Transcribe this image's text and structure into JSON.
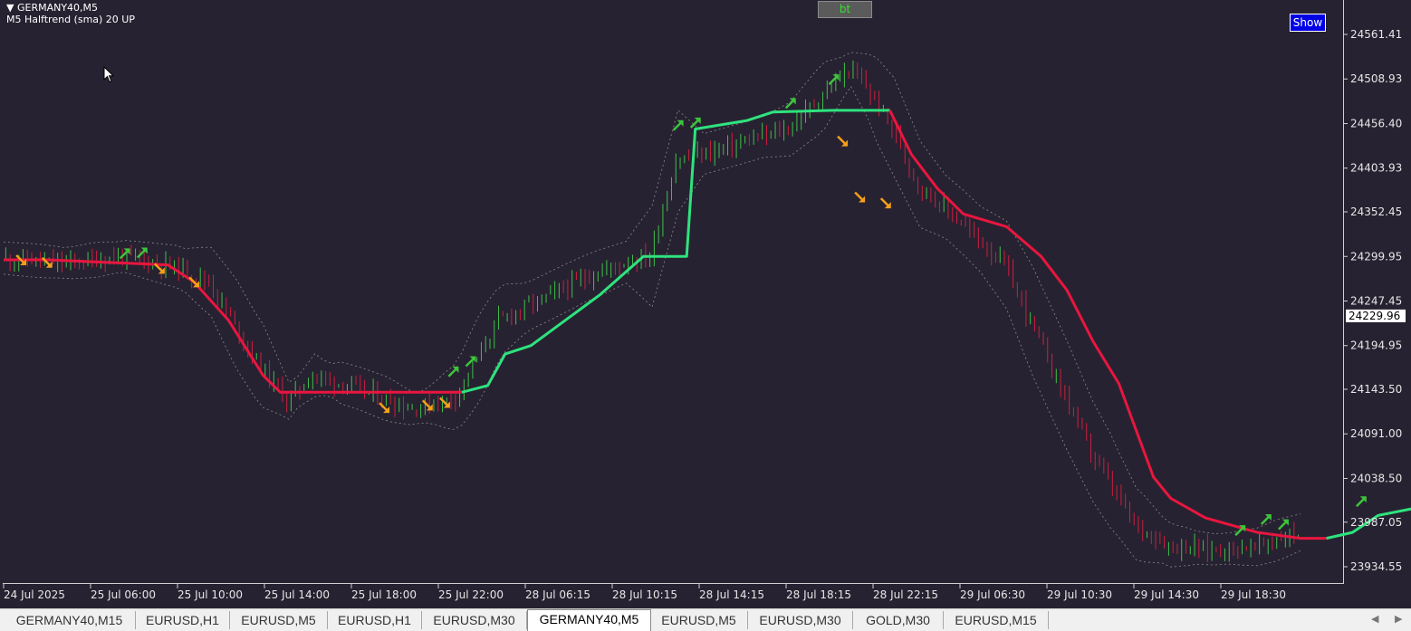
{
  "window": {
    "symbol_title": "GERMANY40,M5",
    "indicator_title": "M5 Halftrend (sma) 20 UP",
    "bt_label": "bt",
    "show_label": "Show"
  },
  "colors": {
    "background": "#272231",
    "axis": "#cfcfcf",
    "up_trend": "#2ee37d",
    "down_trend": "#e8163f",
    "bull_candle": "#3fbf4a",
    "bear_candle": "#c8203f",
    "buy_arrow": "#3cc43c",
    "sell_arrow": "#f4a01a",
    "band": "#8a8a8a"
  },
  "chart_data": {
    "type": "line",
    "symbol": "GERMANY40",
    "timeframe": "M5",
    "ylim": [
      23910,
      24585
    ],
    "y_ticks": [
      "24561.41",
      "24508.93",
      "24456.40",
      "24403.93",
      "24352.45",
      "24299.95",
      "24247.45",
      "24194.95",
      "24143.50",
      "24091.00",
      "24038.50",
      "23987.05",
      "23934.55"
    ],
    "x_ticks": [
      "24 Jul 2025",
      "25 Jul 06:00",
      "25 Jul 10:00",
      "25 Jul 14:00",
      "25 Jul 18:00",
      "25 Jul 22:00",
      "28 Jul 06:15",
      "28 Jul 10:15",
      "28 Jul 14:15",
      "28 Jul 18:15",
      "28 Jul 22:15",
      "29 Jul 06:30",
      "29 Jul 10:30",
      "29 Jul 14:30",
      "29 Jul 18:30"
    ],
    "current_price": "24229.96",
    "x_count": 300,
    "price_path": [
      [
        0,
        24298
      ],
      [
        15,
        24292
      ],
      [
        28,
        24300
      ],
      [
        40,
        24288
      ],
      [
        48,
        24270
      ],
      [
        58,
        24185
      ],
      [
        66,
        24130
      ],
      [
        72,
        24160
      ],
      [
        82,
        24145
      ],
      [
        95,
        24120
      ],
      [
        105,
        24135
      ],
      [
        115,
        24225
      ],
      [
        125,
        24250
      ],
      [
        135,
        24275
      ],
      [
        145,
        24295
      ],
      [
        150,
        24300
      ],
      [
        156,
        24412
      ],
      [
        170,
        24432
      ],
      [
        182,
        24450
      ],
      [
        192,
        24500
      ],
      [
        196,
        24520
      ],
      [
        200,
        24500
      ],
      [
        206,
        24452
      ],
      [
        212,
        24385
      ],
      [
        222,
        24340
      ],
      [
        232,
        24290
      ],
      [
        242,
        24180
      ],
      [
        252,
        24070
      ],
      [
        262,
        23985
      ],
      [
        270,
        23960
      ],
      [
        280,
        23955
      ],
      [
        290,
        23958
      ],
      [
        300,
        23975
      ],
      [
        310,
        23995
      ],
      [
        320,
        24005
      ],
      [
        330,
        24020
      ],
      [
        340,
        24050
      ],
      [
        348,
        24120
      ],
      [
        358,
        24185
      ],
      [
        368,
        24260
      ],
      [
        374,
        24300
      ],
      [
        380,
        24255
      ],
      [
        392,
        24280
      ],
      [
        400,
        24245
      ],
      [
        410,
        24255
      ],
      [
        420,
        24235
      ],
      [
        430,
        24235
      ]
    ],
    "halftrend": [
      {
        "trend": "down",
        "points": [
          [
            0,
            24296
          ],
          [
            10,
            24296
          ],
          [
            38,
            24290
          ],
          [
            44,
            24270
          ],
          [
            52,
            24225
          ],
          [
            60,
            24160
          ],
          [
            64,
            24140
          ],
          [
            96,
            24140
          ],
          [
            106,
            24140
          ]
        ]
      },
      {
        "trend": "up",
        "points": [
          [
            106,
            24140
          ],
          [
            112,
            24148
          ],
          [
            116,
            24185
          ],
          [
            122,
            24195
          ],
          [
            130,
            24225
          ],
          [
            138,
            24255
          ],
          [
            148,
            24300
          ],
          [
            158,
            24300
          ],
          [
            160,
            24450
          ],
          [
            172,
            24460
          ],
          [
            178,
            24470
          ],
          [
            192,
            24472
          ],
          [
            205,
            24472
          ]
        ]
      },
      {
        "trend": "down",
        "points": [
          [
            205,
            24472
          ],
          [
            210,
            24420
          ],
          [
            216,
            24380
          ],
          [
            222,
            24350
          ],
          [
            232,
            24335
          ],
          [
            240,
            24300
          ],
          [
            246,
            24260
          ],
          [
            252,
            24200
          ],
          [
            258,
            24150
          ],
          [
            262,
            24095
          ],
          [
            266,
            24040
          ],
          [
            270,
            24015
          ],
          [
            278,
            23992
          ],
          [
            290,
            23975
          ],
          [
            300,
            23968
          ],
          [
            306,
            23968
          ]
        ]
      },
      {
        "trend": "up",
        "points": [
          [
            306,
            23968
          ],
          [
            312,
            23975
          ],
          [
            318,
            23995
          ],
          [
            328,
            24005
          ],
          [
            342,
            24005
          ],
          [
            348,
            24030
          ],
          [
            352,
            24050
          ],
          [
            356,
            24100
          ],
          [
            360,
            24165
          ],
          [
            366,
            24195
          ],
          [
            372,
            24230
          ],
          [
            378,
            24245
          ],
          [
            430,
            24245
          ]
        ]
      }
    ],
    "signals": [
      {
        "type": "sell",
        "x": 4,
        "price": 24296
      },
      {
        "type": "sell",
        "x": 10,
        "price": 24293
      },
      {
        "type": "buy",
        "x": 28,
        "price": 24303
      },
      {
        "type": "buy",
        "x": 32,
        "price": 24304
      },
      {
        "type": "sell",
        "x": 36,
        "price": 24286
      },
      {
        "type": "sell",
        "x": 44,
        "price": 24270
      },
      {
        "type": "sell",
        "x": 88,
        "price": 24122
      },
      {
        "type": "sell",
        "x": 98,
        "price": 24125
      },
      {
        "type": "sell",
        "x": 102,
        "price": 24128
      },
      {
        "type": "buy",
        "x": 104,
        "price": 24164
      },
      {
        "type": "buy",
        "x": 108,
        "price": 24176
      },
      {
        "type": "buy",
        "x": 156,
        "price": 24454
      },
      {
        "type": "buy",
        "x": 160,
        "price": 24457
      },
      {
        "type": "buy",
        "x": 182,
        "price": 24480
      },
      {
        "type": "buy",
        "x": 192,
        "price": 24508
      },
      {
        "type": "sell",
        "x": 194,
        "price": 24436
      },
      {
        "type": "sell",
        "x": 198,
        "price": 24370
      },
      {
        "type": "sell",
        "x": 204,
        "price": 24363
      },
      {
        "type": "buy",
        "x": 286,
        "price": 23977
      },
      {
        "type": "buy",
        "x": 292,
        "price": 23990
      },
      {
        "type": "buy",
        "x": 296,
        "price": 23984
      },
      {
        "type": "buy",
        "x": 314,
        "price": 24011
      },
      {
        "type": "buy",
        "x": 328,
        "price": 24017
      },
      {
        "type": "buy",
        "x": 336,
        "price": 24065
      },
      {
        "type": "buy",
        "x": 378,
        "price": 24252
      },
      {
        "type": "sell",
        "x": 394,
        "price": 24197
      },
      {
        "type": "sell",
        "x": 398,
        "price": 24201
      },
      {
        "type": "sell",
        "x": 400,
        "price": 24205
      },
      {
        "type": "buy",
        "x": 408,
        "price": 24249
      },
      {
        "type": "buy",
        "x": 412,
        "price": 24242
      },
      {
        "type": "sell",
        "x": 422,
        "price": 24233
      }
    ]
  },
  "tabs": [
    {
      "label": "GERMANY40,M15",
      "active": false
    },
    {
      "label": "EURUSD,H1",
      "active": false
    },
    {
      "label": "EURUSD,M5",
      "active": false
    },
    {
      "label": "EURUSD,H1",
      "active": false
    },
    {
      "label": "EURUSD,M30",
      "active": false
    },
    {
      "label": "GERMANY40,M5",
      "active": true
    },
    {
      "label": "EURUSD,M5",
      "active": false
    },
    {
      "label": "EURUSD,M30",
      "active": false
    },
    {
      "label": "GOLD,M30",
      "active": false
    },
    {
      "label": "EURUSD,M15",
      "active": false
    }
  ],
  "tab_nav": {
    "prev_icon": "◀",
    "next_icon": "▶"
  }
}
